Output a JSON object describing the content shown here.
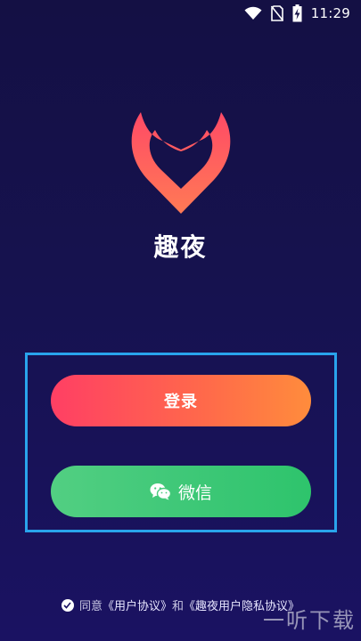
{
  "status_bar": {
    "time": "11:29",
    "icons": [
      "wifi-icon",
      "no-sim-icon",
      "battery-charging-icon"
    ]
  },
  "app": {
    "title": "趣夜",
    "logo_icon": "heart-logo-icon",
    "brand_colors": [
      "#ff4a5f",
      "#ff7d55"
    ]
  },
  "actions": {
    "login_label": "登录",
    "wechat_label": "微信",
    "wechat_icon": "wechat-icon"
  },
  "agreement": {
    "prefix": "同意",
    "user_agreement": "《用户协议》",
    "and": "和",
    "privacy_agreement": "《趣夜用户隐私协议》"
  },
  "watermark": {
    "text": "一听下载"
  }
}
